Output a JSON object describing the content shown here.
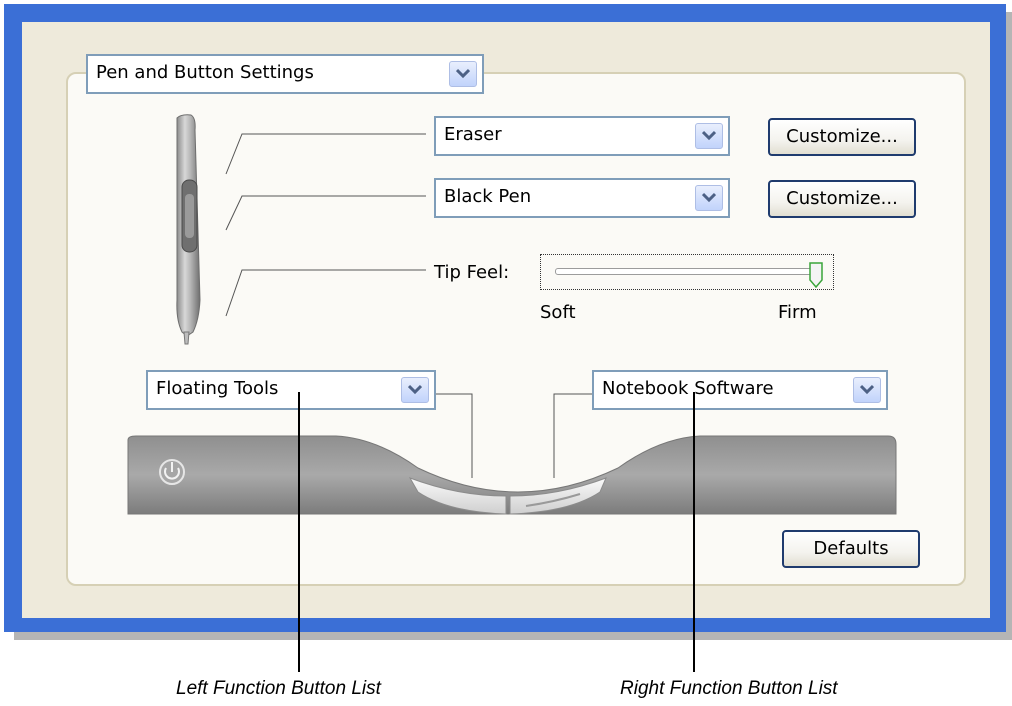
{
  "settings_select": {
    "value": "Pen and Button Settings"
  },
  "pen": {
    "upper_button": {
      "value": "Eraser",
      "customize_label": "Customize..."
    },
    "lower_button": {
      "value": "Black Pen",
      "customize_label": "Customize..."
    },
    "tip_feel": {
      "label": "Tip Feel:",
      "min_label": "Soft",
      "max_label": "Firm",
      "level": 1.0
    }
  },
  "function_buttons": {
    "left": {
      "value": "Floating Tools"
    },
    "right": {
      "value": "Notebook Software"
    }
  },
  "defaults_label": "Defaults",
  "captions": {
    "left": "Left Function Button List",
    "right": "Right Function Button List"
  },
  "colors": {
    "frame": "#3b6fd6",
    "panel": "#eeeadb",
    "dropdown_arrow": "#4d6185"
  }
}
